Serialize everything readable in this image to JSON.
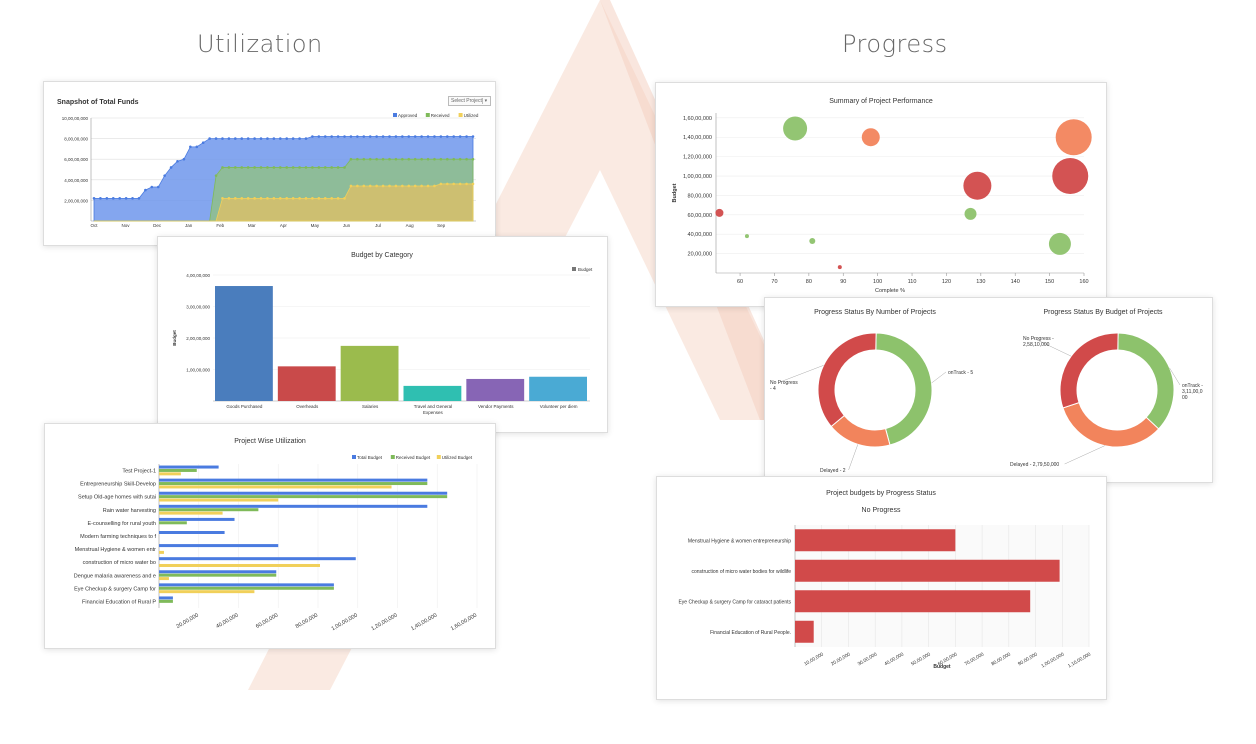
{
  "headings": {
    "left": "Utilization",
    "right": "Progress"
  },
  "colors": {
    "blue": "#4a7be0",
    "green": "#7fba5a",
    "yellow": "#f1d05a",
    "red": "#d14a4a",
    "orange": "#f2845c",
    "bubble_green": "#8dc26c",
    "watermark": "#f8e1d6"
  },
  "snapshot": {
    "title": "Snapshot of Total Funds",
    "select_label": "Select Project",
    "chart_data": {
      "type": "area",
      "title": "Snapshot of Total Funds",
      "x_ticks": [
        "Oct",
        "Nov",
        "Dec",
        "Jan",
        "Feb",
        "Mar",
        "Apr",
        "May",
        "Jun",
        "Jul",
        "Aug",
        "Sep"
      ],
      "y_ticks": [
        "10,00,00,000",
        "8,00,00,000",
        "6,00,00,000",
        "4,00,00,000",
        "2,00,00,000"
      ],
      "ylim": [
        0,
        100000000
      ],
      "series": [
        {
          "name": "Approved",
          "values": [
            22,
            22,
            22,
            22,
            22,
            22,
            22,
            22,
            30,
            33,
            33,
            44,
            52,
            58,
            60,
            72,
            72,
            76,
            80,
            80,
            80,
            80,
            80,
            80,
            80,
            80,
            80,
            80,
            80,
            80,
            80,
            80,
            80,
            80,
            82,
            82,
            82,
            82,
            82,
            82,
            82,
            82,
            82,
            82,
            82,
            82,
            82,
            82,
            82,
            82,
            82,
            82,
            82,
            82,
            82,
            82,
            82,
            82,
            82,
            82
          ]
        },
        {
          "name": "Received",
          "values": [
            0,
            0,
            0,
            0,
            0,
            0,
            0,
            0,
            0,
            0,
            0,
            0,
            0,
            0,
            0,
            0,
            0,
            0,
            0,
            44,
            52,
            52,
            52,
            52,
            52,
            52,
            52,
            52,
            52,
            52,
            52,
            52,
            52,
            52,
            52,
            52,
            52,
            52,
            52,
            52,
            60,
            60,
            60,
            60,
            60,
            60,
            60,
            60,
            60,
            60,
            60,
            60,
            60,
            60,
            60,
            60,
            60,
            60,
            60,
            60
          ]
        },
        {
          "name": "Utilized",
          "values": [
            0,
            0,
            0,
            0,
            0,
            0,
            0,
            0,
            0,
            0,
            0,
            0,
            0,
            0,
            0,
            0,
            0,
            0,
            0,
            0,
            22,
            22,
            22,
            22,
            22,
            22,
            22,
            22,
            22,
            22,
            22,
            22,
            22,
            22,
            22,
            22,
            22,
            22,
            22,
            22,
            34,
            34,
            34,
            34,
            34,
            34,
            34,
            34,
            34,
            34,
            34,
            34,
            34,
            34,
            36,
            36,
            36,
            36,
            36,
            36
          ]
        }
      ],
      "value_unit_note": "values are in lakhs x 10 (0-100 maps to 0-10,00,00,000)"
    }
  },
  "budget_category": {
    "chart_data": {
      "type": "bar",
      "title": "Budget by Category",
      "ylabel": "Budget",
      "legend": [
        "Budget"
      ],
      "categories": [
        "Goods Purchased",
        "Overheads",
        "Salaries",
        "Travel and General Expenses",
        "Vendor Payments",
        "Volunteer per diem"
      ],
      "category_lines": [
        [
          "Goods Purchased"
        ],
        [
          "Overheads"
        ],
        [
          "Salaries"
        ],
        [
          "Travel and General",
          "Expenses"
        ],
        [
          "Vendor Payments"
        ],
        [
          "Volunteer per diem"
        ]
      ],
      "values": [
        36500000,
        11000000,
        17500000,
        4800000,
        7000000,
        7700000
      ],
      "colors": [
        "#4a7dbd",
        "#c94a4a",
        "#9bbb4d",
        "#2fbfb1",
        "#8765b5",
        "#4aaad4"
      ],
      "ylim": [
        0,
        40000000
      ],
      "y_ticks": [
        "4,00,00,000",
        "3,00,00,000",
        "2,00,00,000",
        "1,00,00,000"
      ]
    }
  },
  "project_wise": {
    "chart_data": {
      "type": "bar",
      "title": "Project Wise Utilization",
      "categories": [
        "Test Project-1",
        "Entrepreneurship Skill-Develop",
        "Setup Old-age homes with sutai",
        "Rain water harvesting",
        "E-counselling for rural youth",
        "Modern farming techniques to f",
        "Menstrual Hygiene & women entr",
        "construction of micro water bo",
        "Dengue malaria awareness and e",
        "Eye Checkup & surgery Camp for",
        "Financial Education of Rural P"
      ],
      "series": [
        {
          "name": "Total Budget",
          "values": [
            30000000,
            135000000,
            145000000,
            135000000,
            38000000,
            33000000,
            60000000,
            99000000,
            59000000,
            88000000,
            7000000
          ]
        },
        {
          "name": "Received Budget",
          "values": [
            19000000,
            135000000,
            145000000,
            50000000,
            14000000,
            0,
            0,
            0,
            59000000,
            88000000,
            7000000
          ]
        },
        {
          "name": "Utilized Budget",
          "values": [
            11000000,
            117000000,
            60000000,
            32000000,
            0,
            0,
            2500000,
            81000000,
            5000000,
            48000000,
            0
          ]
        }
      ],
      "xlim": [
        0,
        160000000
      ],
      "x_ticks": [
        "20,00,000",
        "40,00,000",
        "60,00,000",
        "80,00,000",
        "1,00,00,000",
        "1,20,00,000",
        "1,40,00,000",
        "1,60,00,000"
      ]
    }
  },
  "performance": {
    "chart_data": {
      "type": "scatter",
      "title": "Summary of Project Performance",
      "xlabel": "Complete %",
      "ylabel": "Budget",
      "xlim": [
        53,
        160
      ],
      "ylim": [
        0,
        165000000
      ],
      "x_ticks": [
        60,
        70,
        80,
        90,
        100,
        110,
        120,
        130,
        140,
        150,
        160
      ],
      "y_ticks": [
        {
          "v": 20000000,
          "t": "20,00,000"
        },
        {
          "v": 40000000,
          "t": "40,00,000"
        },
        {
          "v": 60000000,
          "t": "60,00,000"
        },
        {
          "v": 80000000,
          "t": "80,00,000"
        },
        {
          "v": 100000000,
          "t": "1,00,00,000"
        },
        {
          "v": 120000000,
          "t": "1,20,00,000"
        },
        {
          "v": 140000000,
          "t": "1,40,00,000"
        },
        {
          "v": 160000000,
          "t": "1,60,00,000"
        }
      ],
      "points": [
        {
          "x": 54,
          "y": 62000000,
          "r": 4,
          "c": "red"
        },
        {
          "x": 62,
          "y": 38000000,
          "r": 2,
          "c": "green"
        },
        {
          "x": 76,
          "y": 149000000,
          "r": 12,
          "c": "green"
        },
        {
          "x": 81,
          "y": 33000000,
          "r": 3,
          "c": "green"
        },
        {
          "x": 89,
          "y": 6000000,
          "r": 2,
          "c": "red"
        },
        {
          "x": 98,
          "y": 140000000,
          "r": 9,
          "c": "orange"
        },
        {
          "x": 127,
          "y": 61000000,
          "r": 6,
          "c": "green"
        },
        {
          "x": 129,
          "y": 90000000,
          "r": 14,
          "c": "red"
        },
        {
          "x": 153,
          "y": 30000000,
          "r": 11,
          "c": "green"
        },
        {
          "x": 156,
          "y": 100000000,
          "r": 18,
          "c": "red"
        },
        {
          "x": 157,
          "y": 140000000,
          "r": 18,
          "c": "orange"
        }
      ]
    }
  },
  "donuts": [
    {
      "chart_data": {
        "type": "pie",
        "title": "Progress Status By Number of Projects",
        "slices": [
          {
            "label": "onTrack - 5",
            "value": 5,
            "c": "green"
          },
          {
            "label": "Delayed - 2",
            "value": 2,
            "c": "orange"
          },
          {
            "label": "No Progress - 4",
            "value": 4,
            "c": "red"
          }
        ],
        "label_lines": [
          [
            "onTrack - 5"
          ],
          [
            "Delayed - 2"
          ],
          [
            "No Progress",
            "- 4"
          ]
        ]
      }
    },
    {
      "chart_data": {
        "type": "pie",
        "title": "Progress Status By Budget of Projects",
        "slices": [
          {
            "label": "onTrack - 3,11,00,000",
            "value": 31100000,
            "c": "green"
          },
          {
            "label": "Delayed - 2,79,50,000",
            "value": 27950000,
            "c": "orange"
          },
          {
            "label": "No Progress - 2,58,10,000",
            "value": 25810000,
            "c": "red"
          }
        ],
        "label_lines": [
          [
            "onTrack -",
            "3,11,00,0",
            "00"
          ],
          [
            "Delayed - 2,79,50,000"
          ],
          [
            "No Progress -",
            "2,58,10,000"
          ]
        ]
      }
    }
  ],
  "progress_budgets": {
    "chart_data": {
      "type": "bar",
      "title": "Project budgets by Progress Status",
      "subtitle": "No Progress",
      "xlabel": "Budget",
      "categories": [
        "Menstrual Hygiene & women entrepreneurship",
        "construction of micro water bodies for wildlife",
        "Eye Checkup & surgery Camp for cataract patients",
        "Financial Education of Rural People."
      ],
      "values": [
        60000000,
        99000000,
        88000000,
        7000000
      ],
      "xlim": [
        0,
        110000000
      ],
      "x_ticks": [
        "10,00,000",
        "20,00,000",
        "30,00,000",
        "40,00,000",
        "50,00,000",
        "60,00,000",
        "70,00,000",
        "80,00,000",
        "90,00,000",
        "1,00,00,000",
        "1,10,00,000"
      ]
    }
  }
}
